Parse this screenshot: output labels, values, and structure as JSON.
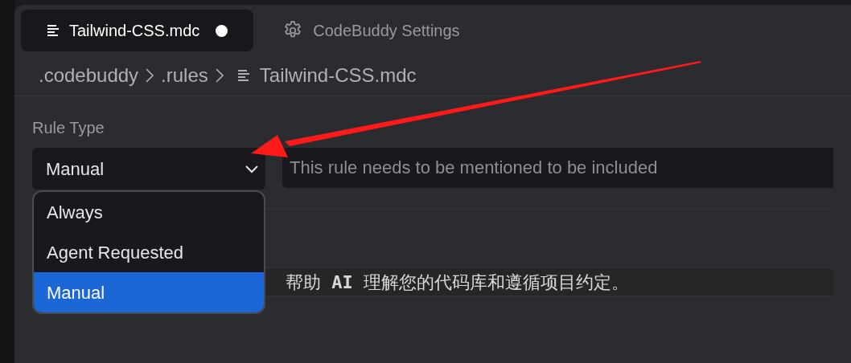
{
  "tabs": [
    {
      "label": "Tailwind-CSS.mdc",
      "kind": "file",
      "modified": true,
      "selected": true
    },
    {
      "label": "CodeBuddy Settings",
      "kind": "settings",
      "modified": false,
      "selected": false
    }
  ],
  "breadcrumb": [
    {
      "label": ".codebuddy",
      "kind": "folder"
    },
    {
      "label": ".rules",
      "kind": "folder"
    },
    {
      "label": "Tailwind-CSS.mdc",
      "kind": "file"
    }
  ],
  "rule_type": {
    "label": "Rule Type",
    "value": "Manual",
    "expanded": true,
    "options": [
      {
        "label": "Always",
        "selected": false
      },
      {
        "label": "Agent Requested",
        "selected": false
      },
      {
        "label": "Manual",
        "selected": true
      }
    ],
    "description_placeholder": "This rule needs to be mentioned to be included"
  },
  "content_line": "帮助 **AI** 理解您的代码库和遵循项目约定。"
}
